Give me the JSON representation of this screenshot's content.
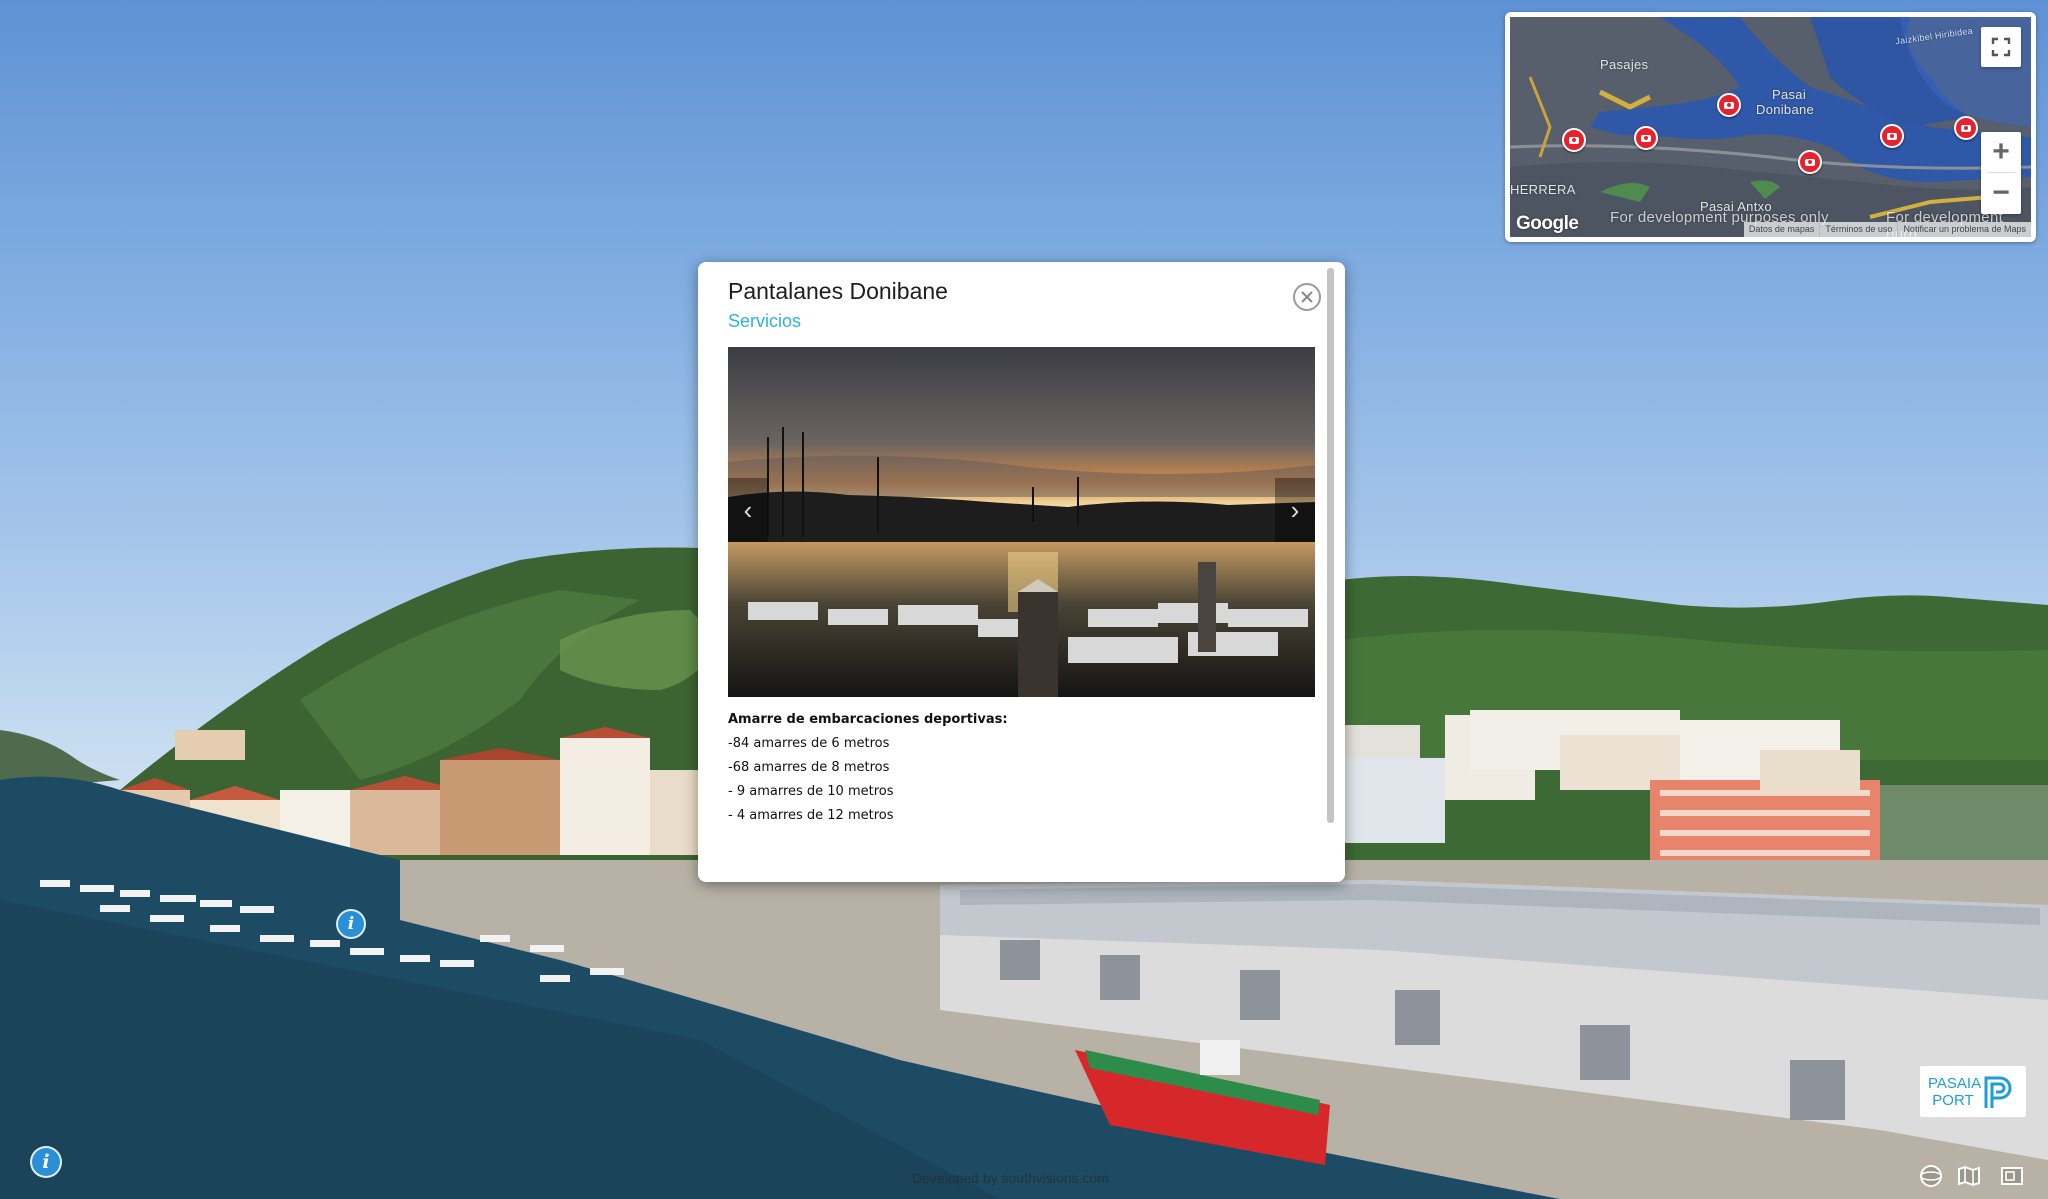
{
  "popup": {
    "title": "Pantalanes Donibane",
    "category": "Servicios",
    "heading": "Amarre de embarcaciones deportivas:",
    "lines": [
      "-84 amarres de 6 metros",
      "-68 amarres de 8 metros",
      "- 9 amarres de 10 metros",
      "- 4 amarres de 12 metros"
    ],
    "prev_label": "‹",
    "next_label": "›"
  },
  "map": {
    "labels": {
      "pasajes": "Pasajes",
      "pasai_donibane_1": "Pasai",
      "pasai_donibane_2": "Donibane",
      "herrera": "HERRERA",
      "pasai_antxo": "Pasai Antxo",
      "jaizkibel": "Jaizkibel Hiribidea",
      "dev_1": "For development purposes only",
      "dev_2": "For development purp"
    },
    "footer": [
      "Datos de mapas",
      "Términos de uso",
      "Notificar un problema de Maps"
    ],
    "logo": "Google",
    "zoom_in": "+",
    "zoom_out": "−"
  },
  "hotspot_glyph": "i",
  "credits": "Developed by southvisions.com",
  "port_logo": {
    "line1": "PASAIA",
    "line2": "PORT",
    "mark": "P"
  },
  "icons": [
    "info-icon",
    "fullscreen-icon",
    "camera-pin-icon",
    "close-icon",
    "gyroscope-icon",
    "map-icon",
    "view-mode-icon"
  ]
}
